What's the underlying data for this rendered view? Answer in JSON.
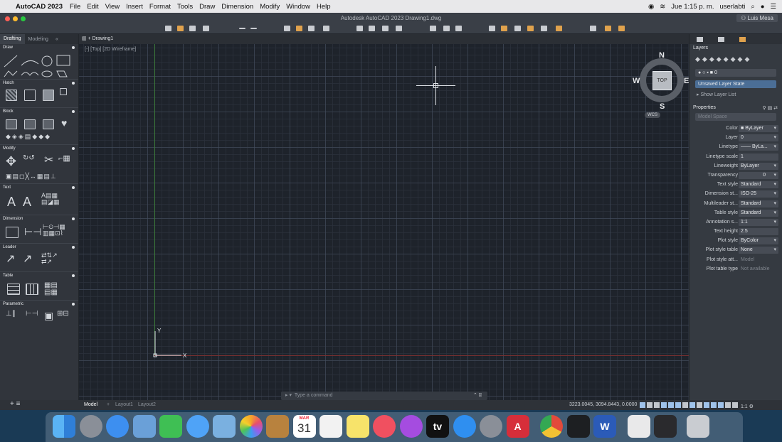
{
  "menubar": {
    "apple": "",
    "app_name": "AutoCAD 2023",
    "items": [
      "File",
      "Edit",
      "View",
      "Insert",
      "Format",
      "Tools",
      "Draw",
      "Dimension",
      "Modify",
      "Window",
      "Help"
    ],
    "clock": "Jue 1:15 p. m.",
    "user": "userlabti"
  },
  "window": {
    "title": "Autodesk AutoCAD 2023   Drawing1.dwg",
    "account": "Luis Mesa"
  },
  "palette": {
    "tabs": [
      "Drafting",
      "Modeling"
    ],
    "sections": [
      "Draw",
      "Hatch",
      "Block",
      "Modify",
      "Text",
      "Dimension",
      "Leader",
      "Table",
      "Parametric"
    ]
  },
  "drawing_tab": "Drawing1",
  "viewport_label": "[-] [Top] [2D Wireframe]",
  "viewcube": {
    "north": "N",
    "south": "S",
    "east": "E",
    "west": "W",
    "face": "TOP",
    "wcs": "WCS"
  },
  "ucs": {
    "x": "X",
    "y": "Y"
  },
  "command_line": {
    "prompt": "Type a command",
    "prefix": "▸ ▾"
  },
  "status": {
    "tabs": [
      "Model",
      "Layout1",
      "Layout2"
    ],
    "coordinates": "3223.0045, 3094.8443, 0.0000",
    "scale": "1:1"
  },
  "layers_panel": {
    "title": "Layers",
    "current_layer": "0",
    "layer_state": "Unsaved Layer State",
    "show_list": "Show Layer List"
  },
  "properties_panel": {
    "title": "Properties",
    "selection": "Model Space",
    "rows": [
      {
        "label": "Color",
        "value": "ByLayer"
      },
      {
        "label": "Layer",
        "value": "0"
      },
      {
        "label": "Linetype",
        "value": "—— ByLa..."
      },
      {
        "label": "Linetype scale",
        "value": "1"
      },
      {
        "label": "Lineweight",
        "value": "ByLayer"
      },
      {
        "label": "Transparency",
        "value": "0"
      },
      {
        "label": "Text style",
        "value": "Standard"
      },
      {
        "label": "Dimension st...",
        "value": "ISO-25"
      },
      {
        "label": "Multileader st...",
        "value": "Standard"
      },
      {
        "label": "Table style",
        "value": "Standard"
      },
      {
        "label": "Annotation s...",
        "value": "1:1"
      },
      {
        "label": "Text height",
        "value": "2.5"
      },
      {
        "label": "Plot style",
        "value": "ByColor"
      },
      {
        "label": "Plot style table",
        "value": "None"
      },
      {
        "label": "Plot style att...",
        "value": "Model"
      },
      {
        "label": "Plot table type",
        "value": "Not available"
      }
    ]
  },
  "dock": {
    "apps": [
      "finder-icon",
      "launchpad-icon",
      "safari-icon",
      "preview-icon",
      "facetime-icon",
      "messages-icon",
      "photo-icon",
      "photos-icon",
      "notes-icon",
      "calendar-icon",
      "reminders-icon",
      "stickies-icon",
      "music-icon",
      "podcasts-icon",
      "appletv-icon",
      "appstore-icon",
      "system-preferences-icon",
      "autocad-icon",
      "chrome-icon",
      "terminal-icon",
      "word-icon",
      "documents-icon",
      "screen-icon",
      "trash-icon"
    ],
    "calendar_month": "MAR",
    "calendar_day": "31",
    "autocad_label": "A",
    "word_label": "W",
    "appletv_label": "tv"
  },
  "colors": {
    "canvas": "#1e232b",
    "ui_dark": "#31353c",
    "accent_blue": "#4b6e96",
    "axis_x": "#7a2f2f",
    "axis_y": "#3c7a3a"
  }
}
